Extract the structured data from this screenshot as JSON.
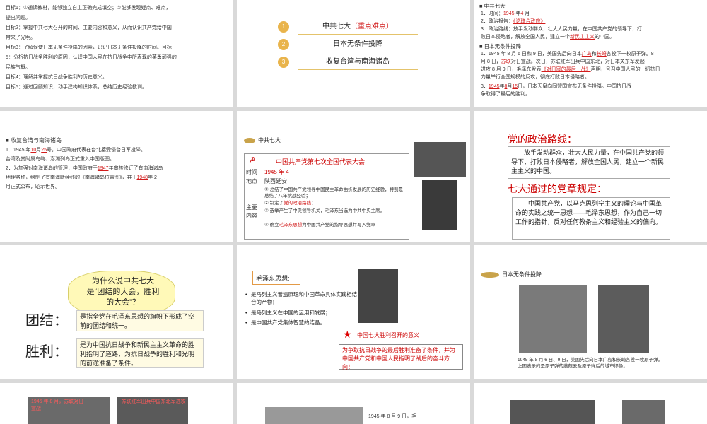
{
  "s1": {
    "lines": [
      "目标1：①通读教材，能够独立自主正确完成填空；②能够发现疑点、难点，",
      "提出问题。",
      "目标2：掌握中共七大召开的时间、主要内容和意义，从而认识共产党给中国",
      "带来了光明。",
      "目标3：了解促使日本无条件投降的因素，识记日本无条件投降的时间。目标",
      "5：分析抗日战争胜利的原因，认识中国人民在抗日战争中所表现的英勇顽强的",
      "民族气概。",
      "目标4：理解并掌握抗日战争胜利的历史意义。",
      "目标5：通过回顾知识，动手建构知识体系，总结历史经验教训。"
    ]
  },
  "s2": {
    "items": [
      {
        "n": "1",
        "main": "中共七大",
        "note": "（重点难点）"
      },
      {
        "n": "2",
        "main": "日本无条件投降",
        "note": ""
      },
      {
        "n": "3",
        "main": "收复台湾与南海诸岛",
        "note": ""
      }
    ]
  },
  "s3": {
    "h1": "中共七大",
    "l1": "1．时间：",
    "year": "1945",
    "mid1": "年",
    "month": "4",
    "end1": "月",
    "l2": "2．政治报告：",
    "report": "《论联合政府》",
    "l3": "3．政治路线：放手发动群众，壮大人民力量，在中国共产党的领导下，打",
    "l3b": "败日本侵略者，解放全国人民，建立一个",
    "l3c": "新民主主义",
    "l3d": "的中国。",
    "h2": "日本无条件投降",
    "l4": "1．1945 年 8 月 6 日和 9 日，美国先后向日本",
    "l4a": "广岛",
    "l4b": "和",
    "l4c": "长崎",
    "l4d": "各投下一枚原子弹。8",
    "l5": "月 8 日，",
    "l5a": "苏联",
    "l5b": "对日宣战。次日，苏联红军出兵中国东北，对日本关东军发起",
    "l6": "进攻 8 月 9 日，毛泽东发表",
    "l6a": "《对日寇的最后一战》",
    "l6b": "声明，号召中国人民的一切抗日",
    "l7": "力量举行全国规模的反攻，彻底打败日本侵略者。",
    "l8a": "3．",
    "l8b": "1945",
    "l8c": "年",
    "l8d": "8",
    "l8e": "月",
    "l8f": "15",
    "l8g": "日，日本天皇向同盟国宣布无条件投降。中国抗日战",
    "l9": "争取得了最后的胜利。"
  },
  "s4": {
    "h": "收复台湾与南海诸岛",
    "l1": "1．1945 年",
    "l1a": "10",
    "l1b": "月",
    "l1c": "25",
    "l1d": "号，中国政府代表在台北接受侵台日军投降。",
    "l2": "台湾及其附属岛屿、澎湖列岛正式重入中国版图。",
    "l3": "2．为加强对南海诸岛的管理，中国政府于",
    "l3a": "1947",
    "l3b": "年审核修订了有南海诸岛",
    "l4": "地理名称，绘制了有南海断续线的《南海诸岛位置图》，并于",
    "l4a": "1948",
    "l4b": "年 2",
    "l5": "月正式公布，昭示世界。"
  },
  "s5": {
    "tag": "中共七大",
    "title": "中国共产党第七次全国代表大会",
    "r1k": "时间",
    "r1v": "1945 年 4",
    "r2k": "地点",
    "r2v": "陕西延安",
    "r3k": "主要内容",
    "c1": "① 总结了中国共产党领导中国民主革命曲折发展的历史经验，特别是总结了八年抗战经验；",
    "c2a": "② 制定了",
    "c2b": "党的政治路线",
    "c2c": "；",
    "c3": "③ 选举产生了中央领导机关，毛泽东当选为中共中央主席。",
    "c4a": "④ 确立",
    "c4b": "毛泽东思想",
    "c4c": "为中国共产党的指导思想并写入党章"
  },
  "s6": {
    "h1": "党的政治路线：",
    "p1": "放手发动群众，壮大人民力量，在中国共产党的领导下，打败日本侵略者，解放全国人民，建立一个新民主主义的中国。",
    "h2": "七大通过的党章规定：",
    "p2": "中国共产党，以马克思列宁主义的理论与中国革命的实践之统一思想——毛泽东思想，作为自己一切工作的指针，反对任何教条主义和经验主义的偏向。"
  },
  "s7": {
    "cloud": "为什么说中共七大是“团结的大会，胜利的大会”？",
    "k1": "团结：",
    "v1": "是指全党在毛泽东思想的旗帜下形成了空前的团结和统一。",
    "k2": "胜利：",
    "v2": "是为中国抗日战争和新民主主义革命的胜利指明了道路，为抗日战争的胜利和光明的前途准备了条件。"
  },
  "s8": {
    "box": "毛泽东思想:",
    "b1": "是马列主义普遍原理和中国革命具体实践相结合的产物；",
    "b2": "是马列主义在中国的运用和发展；",
    "b3": "是中国共产党集体智慧的结晶。",
    "star": "中国七大胜利召开的意义",
    "sig": "为争取抗日战争的最后胜利准备了条件，并为中国共产党和中国人民指明了战后的奋斗方向！"
  },
  "s9": {
    "tag": "日本无条件投降",
    "cap": "1945 年 8 月 6 日、9 日，美国先后向日本广岛和长崎各投一枚原子弹。上图表示的是原子弹的蘑菇云及原子弹后的城市惨像。"
  },
  "s10": {
    "a": "1945 年 8 月，苏联对日宣战",
    "b": "苏联红军出兵中国东北军进攻"
  },
  "s11": {
    "a": "1945 年 8 月 9 日，毛"
  }
}
